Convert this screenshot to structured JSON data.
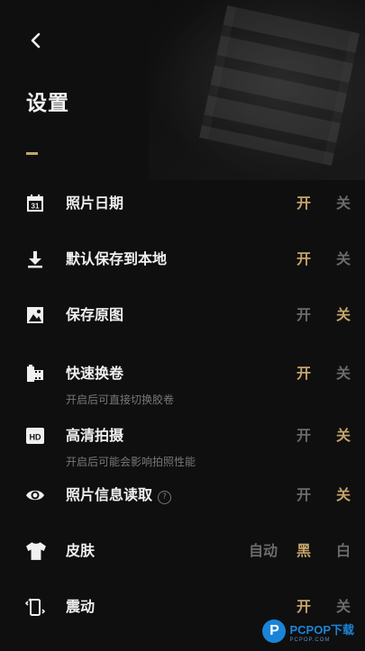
{
  "header": {
    "title": "设置"
  },
  "rows": [
    {
      "label": "照片日期",
      "options": [
        "开",
        "关"
      ],
      "selected": "开"
    },
    {
      "label": "默认保存到本地",
      "options": [
        "开",
        "关"
      ],
      "selected": "开"
    },
    {
      "label": "保存原图",
      "options": [
        "开",
        "关"
      ],
      "selected": "关"
    },
    {
      "label": "快速换卷",
      "sub": "开启后可直接切换胶卷",
      "options": [
        "开",
        "关"
      ],
      "selected": "开"
    },
    {
      "label": "高清拍摄",
      "sub": "开启后可能会影响拍照性能",
      "options": [
        "开",
        "关"
      ],
      "selected": "关"
    },
    {
      "label": "照片信息读取",
      "help": "?",
      "options": [
        "开",
        "关"
      ],
      "selected": "关"
    },
    {
      "label": "皮肤",
      "options": [
        "自动",
        "黑",
        "白"
      ],
      "selected": "黑"
    },
    {
      "label": "震动",
      "options": [
        "开",
        "关"
      ],
      "selected": "开"
    }
  ],
  "icons": {
    "back": "chevron-left-icon",
    "rows": [
      "calendar-icon",
      "download-icon",
      "image-icon",
      "film-roll-icon",
      "hd-icon",
      "eye-icon",
      "tshirt-icon",
      "vibrate-icon"
    ]
  },
  "colors": {
    "accent": "#c6a46a",
    "inactive": "#6b6b6b",
    "background": "#0f0f0f"
  },
  "watermark": {
    "logo": "P",
    "text": "PCPOP下载",
    "subtext": "PCPOP.COM"
  }
}
